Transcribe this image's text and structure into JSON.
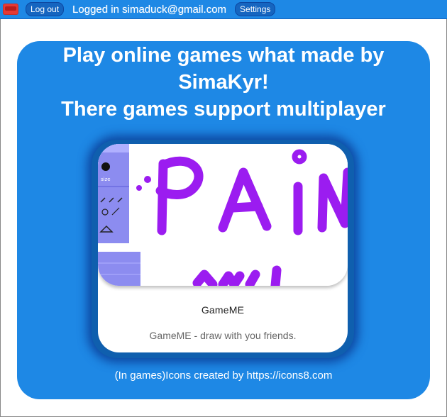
{
  "header": {
    "logout_label": "Log out",
    "logged_in_text": "Logged in simaduck@gmail.com",
    "settings_label": "Settings"
  },
  "main": {
    "headline_lines": [
      "Play online games what made by",
      "SimaKyr!",
      "There games support multiplayer"
    ],
    "game": {
      "title": "GameME",
      "description": "GameME - draw with you friends."
    },
    "credit": "(In games)Icons created by https://icons8.com"
  },
  "colors": {
    "accent": "#1e88e5",
    "paint_purple": "#9b1cf0",
    "toolbar_lilac": "#8c8cf0"
  }
}
